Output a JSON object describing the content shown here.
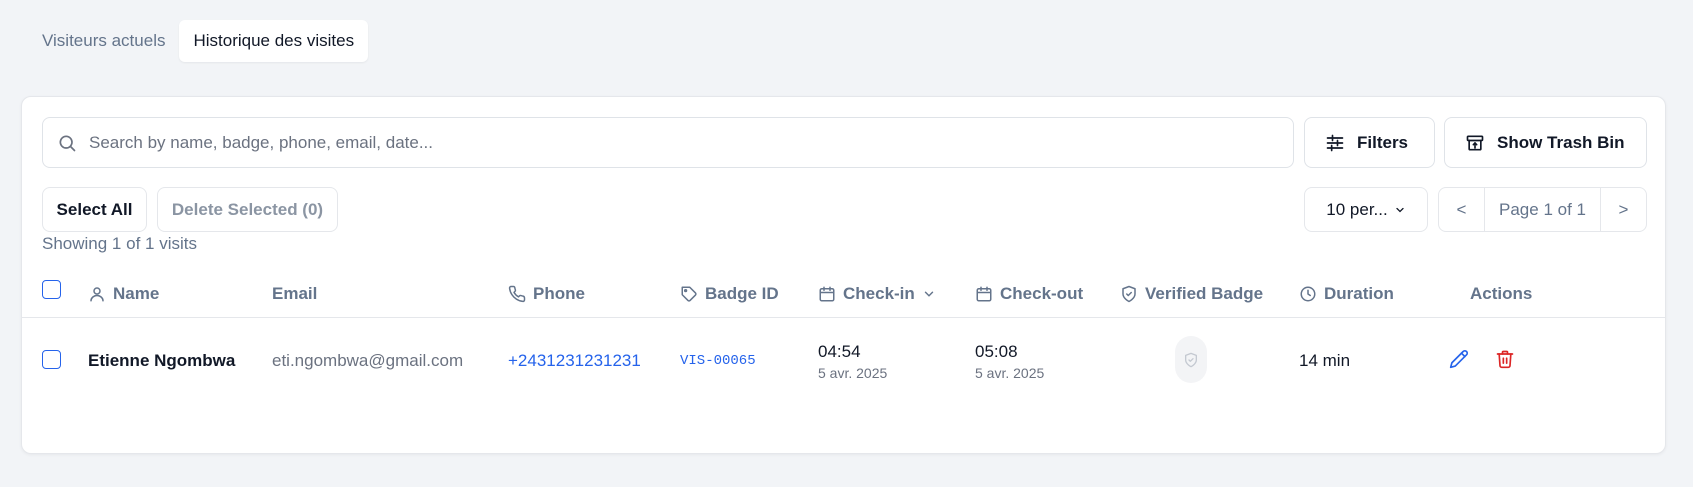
{
  "tabs": [
    {
      "label": "Visiteurs actuels"
    },
    {
      "label": "Historique des visites"
    }
  ],
  "search": {
    "placeholder": "Search by name, badge, phone, email, date..."
  },
  "toolbar": {
    "filters_label": "Filters",
    "trash_label": "Show Trash Bin",
    "select_all_label": "Select All",
    "delete_selected_label": "Delete Selected (0)",
    "per_page_label": "10 per...",
    "prev_label": "<",
    "page_label": "Page 1 of 1",
    "next_label": ">"
  },
  "showing_text": "Showing 1 of 1 visits",
  "columns": {
    "name": "Name",
    "email": "Email",
    "phone": "Phone",
    "badge": "Badge ID",
    "checkin": "Check-in",
    "checkout": "Check-out",
    "verified": "Verified Badge",
    "duration": "Duration",
    "actions": "Actions"
  },
  "rows": [
    {
      "name": "Etienne Ngombwa",
      "email": "eti.ngombwa@gmail.com",
      "phone": "+2431231231231",
      "badge": "VIS-00065",
      "checkin_time": "04:54",
      "checkin_date": "5 avr. 2025",
      "checkout_time": "05:08",
      "checkout_date": "5 avr. 2025",
      "duration": "14 min"
    }
  ],
  "colors": {
    "accent": "#2563eb",
    "danger": "#dc2626",
    "muted": "#64748b"
  }
}
